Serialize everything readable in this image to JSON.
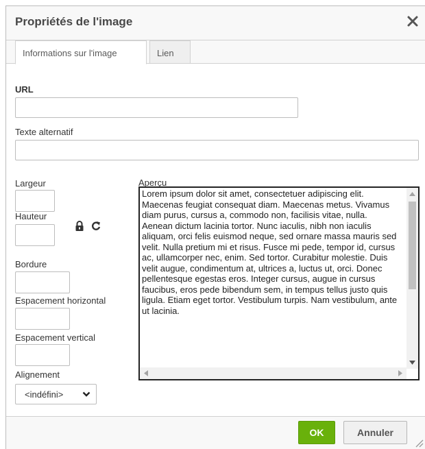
{
  "dialog": {
    "title": "Propriétés de l'image",
    "close_icon": "close-icon"
  },
  "tabs": [
    {
      "label": "Informations sur l'image",
      "active": true
    },
    {
      "label": "Lien",
      "active": false
    }
  ],
  "form": {
    "url_label": "URL",
    "url_value": "",
    "alt_label": "Texte alternatif",
    "alt_value": "",
    "width_label": "Largeur",
    "height_label": "Hauteur",
    "border_label": "Bordure",
    "hspace_label": "Espacement horizontal",
    "vspace_label": "Espacement vertical",
    "align_label": "Alignement",
    "align_value": "<indéfini>",
    "lock_icon": "lock-icon",
    "reset_icon": "refresh-icon"
  },
  "preview": {
    "label": "Aperçu",
    "text": "Lorem ipsum dolor sit amet, consectetuer adipiscing elit. Maecenas feugiat consequat diam. Maecenas metus. Vivamus diam purus, cursus a, commodo non, facilisis vitae, nulla. Aenean dictum lacinia tortor. Nunc iaculis, nibh non iaculis aliquam, orci felis euismod neque, sed ornare massa mauris sed velit. Nulla pretium mi et risus. Fusce mi pede, tempor id, cursus ac, ullamcorper nec, enim. Sed tortor. Curabitur molestie. Duis velit augue, condimentum at, ultrices a, luctus ut, orci. Donec pellentesque egestas eros. Integer cursus, augue in cursus faucibus, eros pede bibendum sem, in tempus tellus justo quis ligula. Etiam eget tortor. Vestibulum turpis. Nam vestibulum, ante ut lacinia."
  },
  "footer": {
    "ok_label": "OK",
    "cancel_label": "Annuler"
  },
  "colors": {
    "ok_button": "#69b10b",
    "title_text": "#484848"
  }
}
